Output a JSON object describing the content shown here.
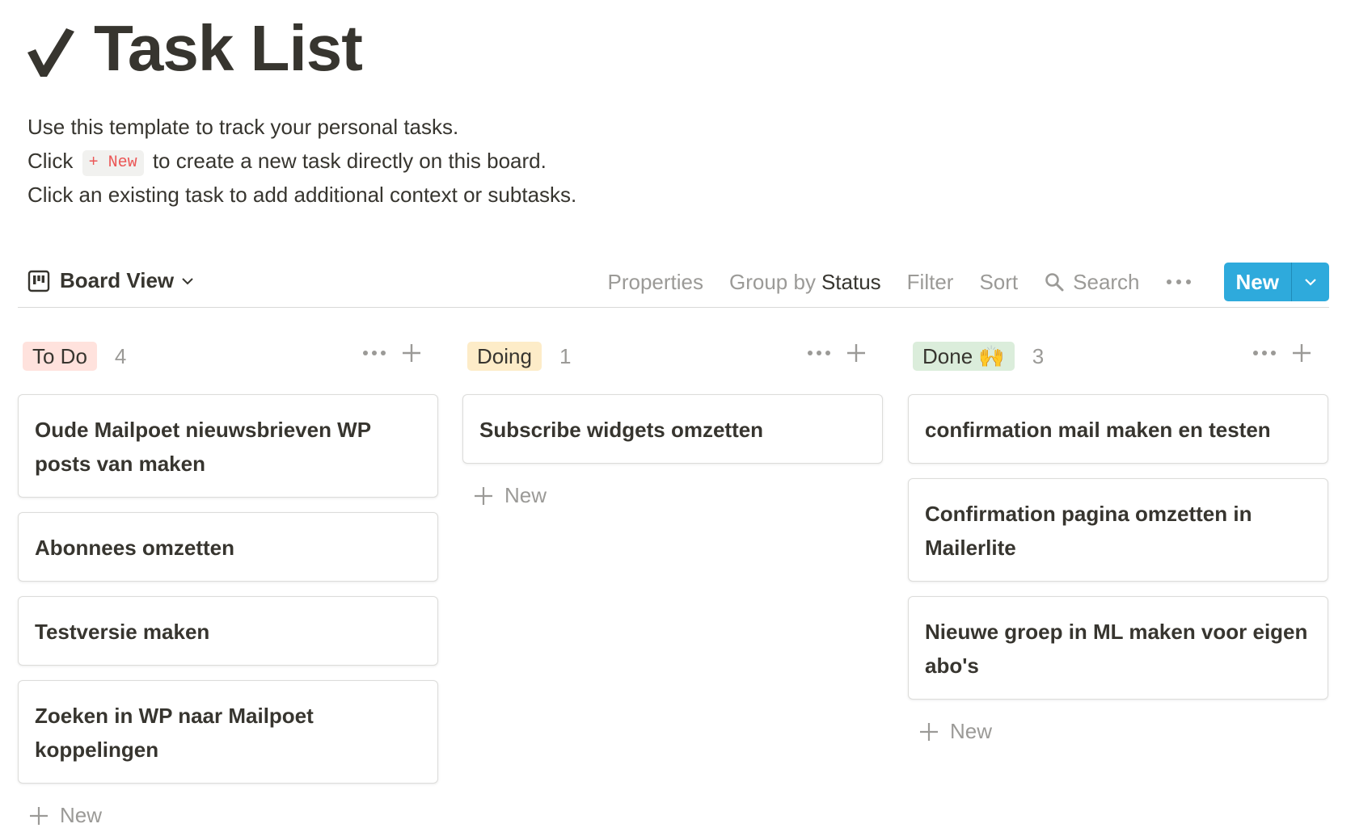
{
  "page": {
    "title": "Task List",
    "description": {
      "line1": "Use this template to track your personal tasks.",
      "line2_pre": "Click",
      "line2_code": "+ New",
      "line2_post": "to create a new task directly on this board.",
      "line3": "Click an existing task to add additional context or subtasks."
    }
  },
  "toolbar": {
    "view_label": "Board View",
    "properties": "Properties",
    "group_by_label": "Group by",
    "group_by_value": "Status",
    "filter": "Filter",
    "sort": "Sort",
    "search": "Search",
    "new_label": "New"
  },
  "colors": {
    "accent": "#2eaadc",
    "todo_tag": "#ffe2dd",
    "doing_tag": "#fdecc8",
    "done_tag": "#dbeddb"
  },
  "columns": [
    {
      "name": "To Do",
      "count": "4",
      "cards": [
        "Oude Mailpoet nieuwsbrieven WP posts van maken",
        "Abonnees omzetten",
        "Testversie maken",
        "Zoeken in WP naar Mailpoet koppelingen"
      ],
      "add_label": "New"
    },
    {
      "name": "Doing",
      "count": "1",
      "cards": [
        "Subscribe widgets omzetten"
      ],
      "add_label": "New"
    },
    {
      "name": "Done 🙌",
      "count": "3",
      "cards": [
        "confirmation mail maken en testen",
        "Confirmation pagina omzetten in Mailerlite",
        "Nieuwe groep in ML maken voor eigen abo's"
      ],
      "add_label": "New"
    }
  ]
}
